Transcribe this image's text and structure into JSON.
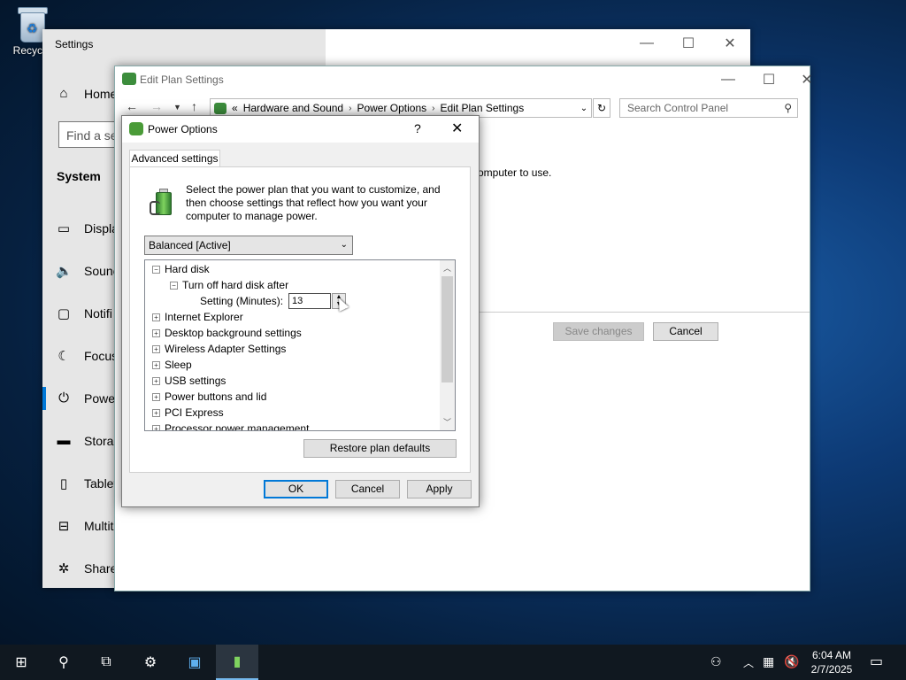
{
  "desktop": {
    "recycle_bin_label": "Recycle"
  },
  "settings": {
    "title": "Settings",
    "home": "Home",
    "find_placeholder": "Find a se",
    "section": "System",
    "items": [
      "Displa",
      "Sounc",
      "Notifi",
      "Focus",
      "Power",
      "Storag",
      "Tablet",
      "Multit",
      "Share"
    ]
  },
  "edit_plan": {
    "title": "Edit Plan Settings",
    "breadcrumb": [
      "«",
      "Hardware and Sound",
      "Power Options",
      "Edit Plan Settings"
    ],
    "search_placeholder": "Search Control Panel",
    "body_text": "omputer to use.",
    "save_label": "Save changes",
    "cancel_label": "Cancel"
  },
  "dialog": {
    "title": "Power Options",
    "help": "?",
    "close": "✕",
    "tab": "Advanced settings",
    "intro": "Select the power plan that you want to customize, and then choose settings that reflect how you want your computer to manage power.",
    "plan_selected": "Balanced [Active]",
    "tree": {
      "hard_disk": "Hard disk",
      "turn_off": "Turn off hard disk after",
      "setting_label": "Setting (Minutes):",
      "setting_value": "13",
      "items": [
        "Internet Explorer",
        "Desktop background settings",
        "Wireless Adapter Settings",
        "Sleep",
        "USB settings",
        "Power buttons and lid",
        "PCI Express",
        "Processor power management"
      ]
    },
    "restore_label": "Restore plan defaults",
    "ok_label": "OK",
    "cancel_label": "Cancel",
    "apply_label": "Apply"
  },
  "taskbar": {
    "time": "6:04 AM",
    "date": "2/7/2025"
  }
}
